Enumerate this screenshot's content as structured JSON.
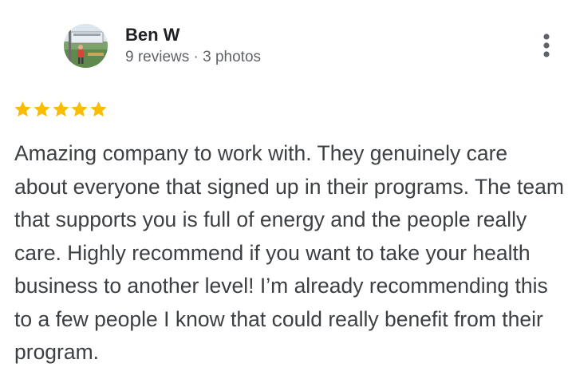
{
  "reviewer": {
    "name": "Ben W",
    "meta": "9 reviews · 3 photos",
    "avatar_icon": "profile-photo-icon"
  },
  "rating": {
    "stars": 5,
    "max_stars": 5,
    "star_color": "#fbbc04"
  },
  "menu": {
    "icon": "more-vert-icon"
  },
  "review": {
    "text": "Amazing company to work with. They genuinely care about everyone that signed up in their programs. The team that supports you is full of energy and the people really care. Highly recommend if you want to take your health business to another level! I’m already recommending this to a few people I know that could really benefit from their program."
  },
  "colors": {
    "name_text": "#202124",
    "meta_text": "#5f6368",
    "body_text": "#3c4043",
    "icon": "#5f6368"
  }
}
